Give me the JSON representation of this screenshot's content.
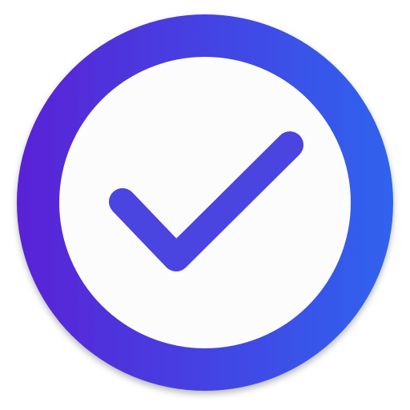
{
  "icon": {
    "name": "checkmark-icon",
    "colors": {
      "ring_start": "#5a22d6",
      "ring_end": "#2f63ee",
      "inner_fill": "#fcfcfd",
      "check_stroke": "#4a44e0",
      "background": "#ffffff"
    }
  }
}
